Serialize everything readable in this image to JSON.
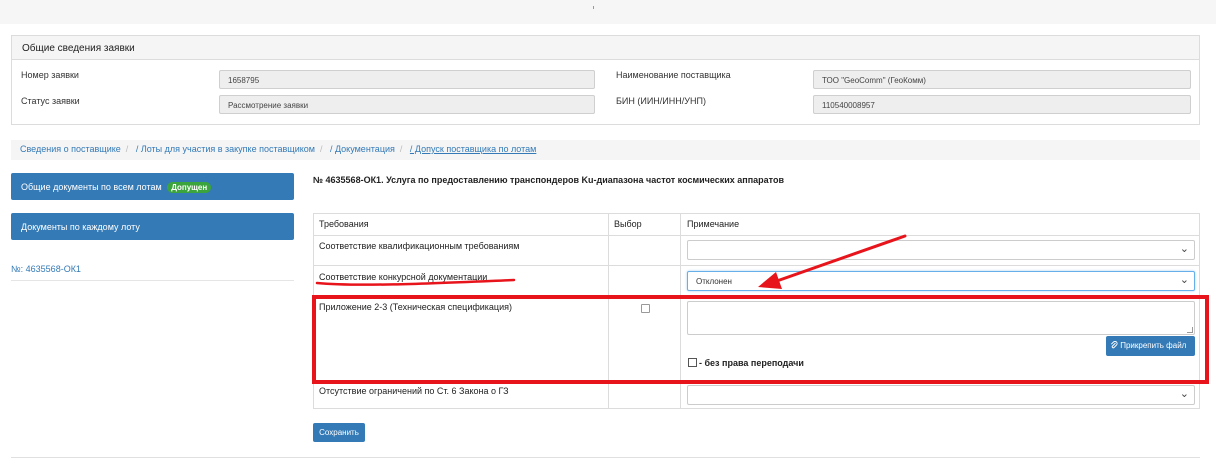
{
  "summary": {
    "title": "Общие сведения заявки",
    "request_number_label": "Номер заявки",
    "request_number": "1658795",
    "status_label": "Статус заявки",
    "status": "Рассмотрение заявки",
    "supplier_name_label": "Наименование поставщика",
    "supplier_name": "ТОО \"GeoComm\" (ГеоКомм)",
    "bin_label": "БИН (ИИН/ИНН/УНП)",
    "bin": "110540008957"
  },
  "breadcrumbs": [
    "Сведения о поставщике",
    "/ Лоты для участия в закупке поставщиком",
    "/ Документация",
    "/ Допуск поставщика по лотам"
  ],
  "sidebar": {
    "general_docs_label": "Общие документы по всем лотам",
    "general_docs_badge": "Допущен",
    "per_lot_docs_label": "Документы по каждому лоту",
    "lot_link": "№: 4635568-ОК1"
  },
  "lot_title": "№ 4635568-ОК1. Услуга по предоставлению транспондеров Ku-диапазона частот космических аппаратов",
  "table": {
    "headers": {
      "requirements": "Требования",
      "choice": "Выбор",
      "note": "Примечание"
    },
    "rows": {
      "qualification": "Соответствие квалификационным требованиям",
      "qualification_value": "",
      "tender_docs": "Соответствие конкурсной документации",
      "tender_docs_value": "Отклонен",
      "appendix": "Приложение 2-3 (Техническая спецификация)",
      "restrictions": "Отсутствие ограничений по Ст. 6 Закона о ГЗ",
      "restrictions_value": ""
    },
    "attach_label": "Прикрепить файл",
    "no_transfer_label": "- без права переподачи"
  },
  "save_label": "Сохранить",
  "colors": {
    "primary": "#337ab7",
    "success": "#3ca43c",
    "annotation": "#e8141c"
  },
  "icons": {
    "select_chevron": "chevron-down-icon",
    "attach": "paperclip-icon"
  }
}
